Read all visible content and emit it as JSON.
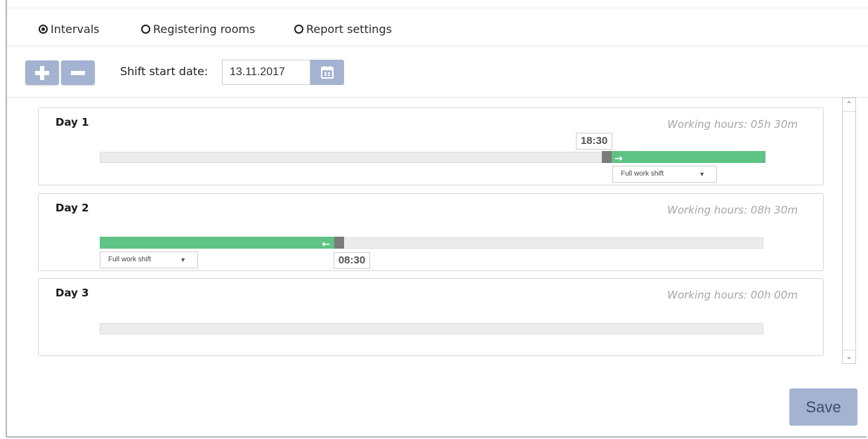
{
  "tabs": [
    {
      "label": "Intervals",
      "checked": true
    },
    {
      "label": "Registering rooms",
      "checked": false
    },
    {
      "label": "Report settings",
      "checked": false
    }
  ],
  "toolbar": {
    "add_icon": "plus-icon",
    "remove_icon": "minus-icon",
    "shift_start_label": "Shift start date:",
    "shift_start_value": "13.11.2017",
    "calendar_icon": "calendar-icon"
  },
  "days": [
    {
      "title": "Day 1",
      "working_hours": "Working hours: 05h 30m",
      "handle_time": "18:30",
      "shift_type": "Full work shift",
      "direction": "right"
    },
    {
      "title": "Day 2",
      "working_hours": "Working hours: 08h 30m",
      "handle_time": "08:30",
      "shift_type": "Full work shift",
      "direction": "left"
    },
    {
      "title": "Day 3",
      "working_hours": "Working hours: 00h 00m"
    }
  ],
  "footer": {
    "save_label": "Save"
  },
  "colors": {
    "button": "#a3b3d1",
    "segment": "#5ec384",
    "handle": "#7b7b7b",
    "track": "#ececec"
  }
}
